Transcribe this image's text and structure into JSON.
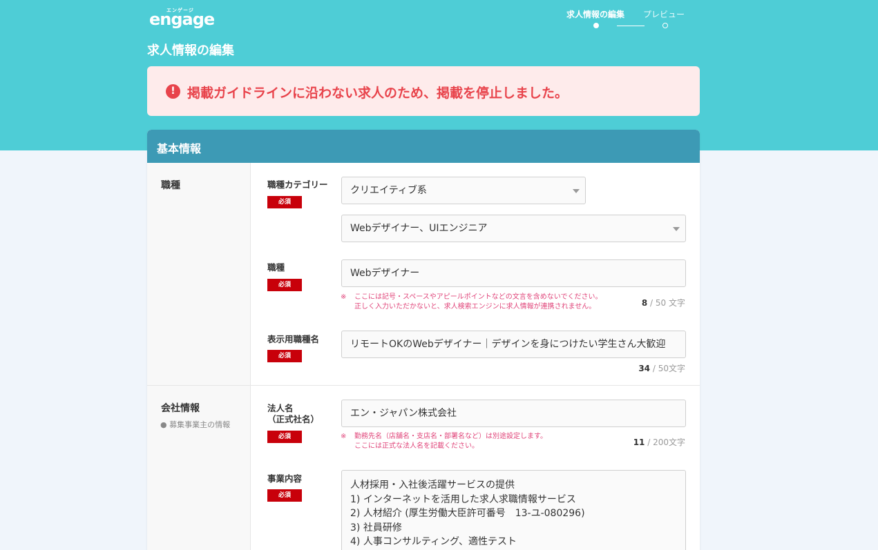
{
  "header": {
    "logo_small": "エンゲージ",
    "logo_main": "engage",
    "steps": [
      {
        "label": "求人情報の編集",
        "active": true
      },
      {
        "label": "プレビュー",
        "active": false
      }
    ],
    "page_title": "求人情報の編集"
  },
  "alert": {
    "icon": "exclamation-icon",
    "text": "掲載ガイドラインに沿わない求人のため、掲載を停止しました。",
    "color": "#e8434b"
  },
  "card": {
    "title": "基本情報",
    "sections": {
      "job": {
        "title": "職種",
        "category_label": "職種カテゴリー",
        "required_label": "必須",
        "category_value": "クリエイティブ系",
        "subcategory_value": "Webデザイナー、UIエンジニア",
        "job_label": "職種",
        "job_value": "Webデザイナー",
        "job_note_mark": "※",
        "job_note_line1": "ここには記号・スペースやアピールポイントなどの文言を含めないでください。",
        "job_note_line2": "正しく入力いただかないと、求人検索エンジンに求人情報が連携されません。",
        "job_count": "8",
        "job_count_sep": "/",
        "job_count_max": "50 文字",
        "display_label": "表示用職種名",
        "display_value": "リモートOKのWebデザイナー｜デザインを身につけたい学生さん大歓迎",
        "display_count": "34",
        "display_count_sep": "/",
        "display_count_max": "50文字"
      },
      "company": {
        "title": "会社情報",
        "subtitle": "● 募集事業主の情報",
        "corp_label_line1": "法人名",
        "corp_label_line2": "（正式社名）",
        "required_label": "必須",
        "corp_value": "エン・ジャパン株式会社",
        "corp_note_mark": "※",
        "corp_note_line1": "勤務先名（店舗名・支店名・部署名など）は別途設定します。",
        "corp_note_line2": "ここには正式な法人名を記載ください。",
        "corp_count": "11",
        "corp_count_sep": "/",
        "corp_count_max": "200文字",
        "business_label": "事業内容",
        "business_lines": [
          "人材採用・入社後活躍サービスの提供",
          "1) インターネットを活用した求人求職情報サービス",
          "2) 人材紹介 (厚生労働大臣許可番号　13-ユ-080296)",
          "3) 社員研修",
          "4) 人事コンサルティング、適性テスト"
        ]
      }
    }
  },
  "colors": {
    "header_bg": "#4ecdd6",
    "card_header_bg": "#3d9ab5",
    "required_bg": "#c8000a",
    "note_text": "#e0457a"
  }
}
